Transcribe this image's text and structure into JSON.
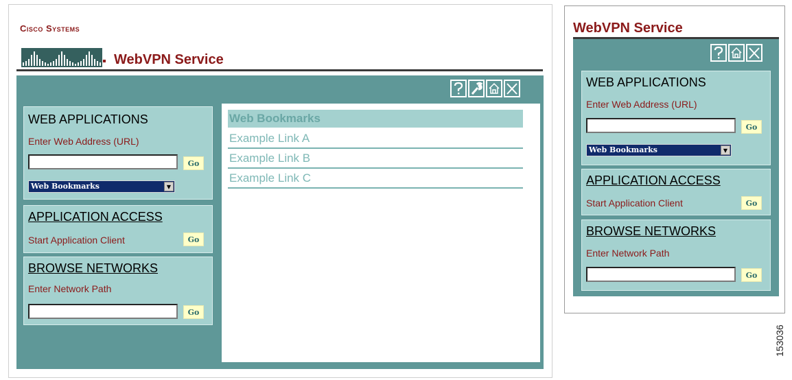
{
  "left_window": {
    "brand": "Cisco Systems",
    "title": "WebVPN Service",
    "toolbar": [
      {
        "icon": "help-icon"
      },
      {
        "icon": "wrench-icon"
      },
      {
        "icon": "home-icon"
      },
      {
        "icon": "close-icon"
      }
    ],
    "web_applications": {
      "heading": "WEB APPLICATIONS",
      "prompt": "Enter Web Address (URL)",
      "url_value": "",
      "go_label": "Go",
      "bookmarks_selected": "Web Bookmarks"
    },
    "application_access": {
      "heading": "APPLICATION ACCESS",
      "prompt": "Start Application Client",
      "go_label": "Go"
    },
    "browse_networks": {
      "heading": "BROWSE NETWORKS",
      "prompt": "Enter Network Path",
      "path_value": "",
      "go_label": "Go"
    },
    "bookmarks_panel": {
      "heading": "Web Bookmarks",
      "links": [
        "Example Link A",
        "Example Link B",
        "Example Link C"
      ]
    }
  },
  "right_window": {
    "title": "WebVPN Service",
    "toolbar": [
      {
        "icon": "help-icon"
      },
      {
        "icon": "home-icon"
      },
      {
        "icon": "close-icon"
      }
    ],
    "web_applications": {
      "heading": "WEB APPLICATIONS",
      "prompt": "Enter Web Address (URL)",
      "url_value": "",
      "go_label": "Go",
      "bookmarks_selected": "Web Bookmarks"
    },
    "application_access": {
      "heading": "APPLICATION ACCESS",
      "prompt": "Start Application Client",
      "go_label": "Go"
    },
    "browse_networks": {
      "heading": "BROWSE NETWORKS",
      "prompt": "Enter Network Path",
      "path_value": "",
      "go_label": "Go"
    }
  },
  "figure_id": "153036",
  "colors": {
    "panel": "#5f9898",
    "box": "#a4d1cf",
    "title": "#8b1a1a",
    "link": "#7fb8b6",
    "go_button": "#ffffc8"
  }
}
